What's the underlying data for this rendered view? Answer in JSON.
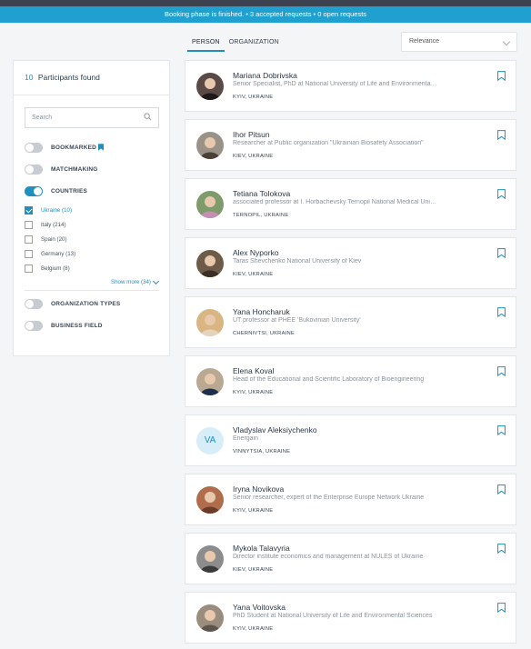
{
  "banner": {
    "text": "Booking phase is finished. • 3 accepted requests • 0 open requests"
  },
  "tabs": [
    {
      "label": "PERSON",
      "active": true
    },
    {
      "label": "ORGANIZATION",
      "active": false
    }
  ],
  "sort": {
    "selected": "Relevance"
  },
  "sidebar": {
    "count": "10",
    "count_label": "Participants found",
    "search_placeholder": "Search",
    "toggles": {
      "bookmarked": "BOOKMARKED",
      "matchmaking": "MATCHMAKING",
      "countries": "COUNTRIES",
      "organization_types": "ORGANIZATION TYPES",
      "business_field": "BUSINESS FIELD"
    },
    "countries": [
      {
        "label": "Ukraine (10)",
        "checked": true
      },
      {
        "label": "Italy (214)",
        "checked": false
      },
      {
        "label": "Spain (20)",
        "checked": false
      },
      {
        "label": "Germany (13)",
        "checked": false
      },
      {
        "label": "Belgium (8)",
        "checked": false
      }
    ],
    "show_more": "Show more (34)"
  },
  "participants": [
    {
      "name": "Mariana Dobrivska",
      "role": "Senior Specialist, PhD at National University of Life and Environmental Sciences of Ukraine",
      "location": "KYIV, UKRAINE",
      "avatar": "photo"
    },
    {
      "name": "Ihor Pitsun",
      "role": "Researcher at Public organization \"Ukrainian Biosafety Association\"",
      "location": "KIEV, UKRAINE",
      "avatar": "photo"
    },
    {
      "name": "Tetiana Tolokova",
      "role": "associated professor at I. Horbachevsky Ternopil National Medical University",
      "location": "TERNOPIL, UKRAINE",
      "avatar": "photo"
    },
    {
      "name": "Alex Nyporko",
      "role": "Taras Shevchenko National University of Kiev",
      "location": "KIEV, UKRAINE",
      "avatar": "photo"
    },
    {
      "name": "Yana Honcharuk",
      "role": "UT professor at PHEE 'Bukovinian University'",
      "location": "CHERNIVTSI, UKRAINE",
      "avatar": "photo"
    },
    {
      "name": "Elena Koval",
      "role": "Head of the Educational and Scientific Laboratory of Bioengineering",
      "location": "KYIV, UKRAINE",
      "avatar": "photo"
    },
    {
      "name": "Vladyslav Aleksiychenko",
      "role": "Energain",
      "location": "VINNYTSIA, UKRAINE",
      "avatar": "VA"
    },
    {
      "name": "Iryna Novikova",
      "role": "Senior researcher, expert of the Enterprise Europe Network Ukraine",
      "location": "KYIV, UKRAINE",
      "avatar": "photo"
    },
    {
      "name": "Mykola Talavyria",
      "role": "Director institute economics and management at NULES of Ukraine",
      "location": "KIEV, UKRAINE",
      "avatar": "photo"
    },
    {
      "name": "Yana Voitovska",
      "role": "PhD Student at National University of Life and Environmental Sciences",
      "location": "KYIV, UKRAINE",
      "avatar": "photo"
    }
  ],
  "colors": {
    "accent": "#1f8fc0",
    "banner": "#1fa0cf",
    "background": "#f4f5f7"
  }
}
